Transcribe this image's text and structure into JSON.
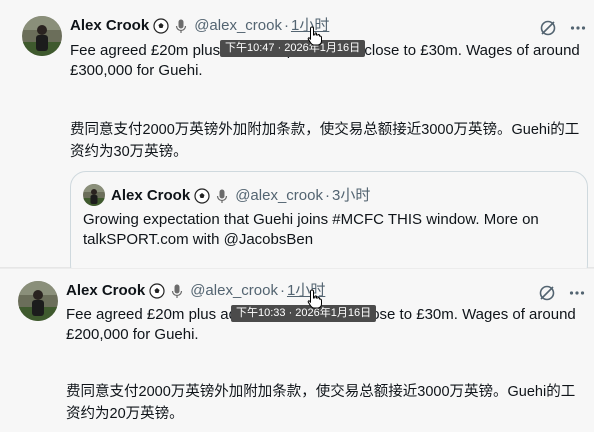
{
  "tweets": [
    {
      "author": "Alex Crook",
      "handle": "@alex_crook",
      "sep": "·",
      "time": "1小时",
      "tooltip": "下午10:47 · 2026年1月16日",
      "text_en": "Fee agreed £20m plus add-ons, potential to close to £30m. Wages of around £300,000 for Guehi.",
      "text_zh": "费同意支付2000万英镑外加附加条款，使交易总额接近3000万英镑。Guehi的工资约为30万英镑。",
      "quote": {
        "author": "Alex Crook",
        "handle": "@alex_crook",
        "sep": "·",
        "time": "3小时",
        "text": "Growing expectation that Guehi joins #MCFC THIS window. More on talkSPORT.com with @JacobsBen"
      }
    },
    {
      "author": "Alex Crook",
      "handle": "@alex_crook",
      "sep": "·",
      "time": "1小时",
      "tooltip": "下午10:33 · 2026年1月16日",
      "text_en": "Fee agreed £20m plus add-ons, potential to close to £30m. Wages of around £200,000 for Guehi.",
      "text_zh": "费同意支付2000万英镑外加附加条款，使交易总额接近3000万英镑。Guehi的工资约为20万英镑。"
    }
  ],
  "icons": {
    "ball": "soccer-ball-icon",
    "mic": "microphone-icon",
    "grok": "grok-icon",
    "more": "more-icon",
    "cursor": "hand-cursor-icon"
  },
  "colors": {
    "secondary": "#536471",
    "tooltip": "#4b4b4b",
    "border": "#cfd9de"
  }
}
